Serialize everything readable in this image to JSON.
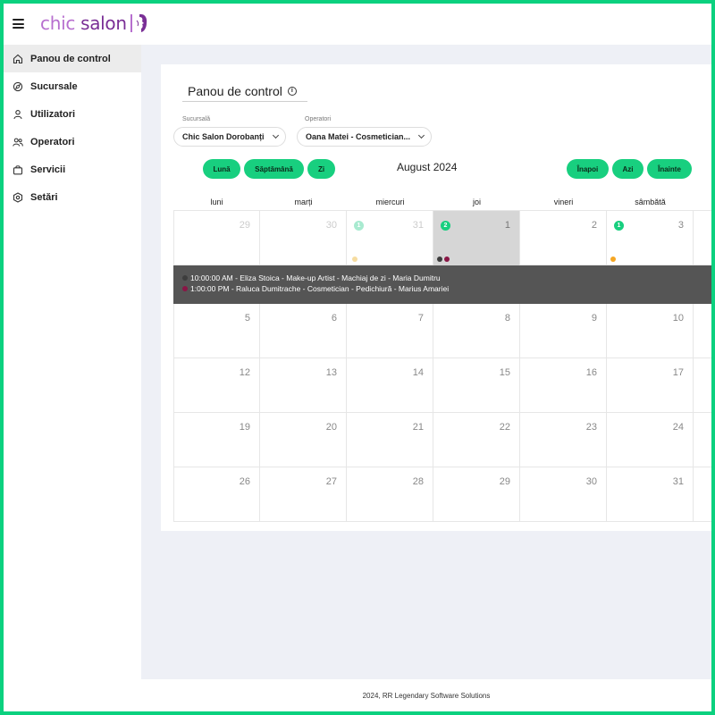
{
  "app": {
    "logo_chic": "chic ",
    "logo_salon": "salon",
    "footer": "2024, RR Legendary Software Solutions"
  },
  "sidebar": {
    "items": [
      {
        "label": "Panou de control",
        "icon": "home-icon"
      },
      {
        "label": "Sucursale",
        "icon": "compass-icon"
      },
      {
        "label": "Utilizatori",
        "icon": "user-icon"
      },
      {
        "label": "Operatori",
        "icon": "users-icon"
      },
      {
        "label": "Servicii",
        "icon": "bag-icon"
      },
      {
        "label": "Setări",
        "icon": "settings-icon"
      }
    ]
  },
  "dashboard": {
    "title": "Panou de control",
    "branch_label": "Sucursală",
    "branch_value": "Chic Salon Dorobanți",
    "operator_label": "Operatori",
    "operator_value": "Oana Matei - Cosmetician...",
    "view_month": "Lună",
    "view_week": "Săptămână",
    "view_day": "Zi",
    "month_title": "August 2024",
    "nav_back": "Înapoi",
    "nav_today": "Azi",
    "nav_next": "Înainte"
  },
  "calendar": {
    "weekdays": [
      "luni",
      "marți",
      "miercuri",
      "joi",
      "vineri",
      "sâmbătă"
    ],
    "week1": [
      {
        "num": "29",
        "muted": true
      },
      {
        "num": "30",
        "muted": true
      },
      {
        "num": "31",
        "muted": true,
        "badge": "1",
        "badge_faded": true,
        "dots": [
          "#f6dca0"
        ]
      },
      {
        "num": "1",
        "today": true,
        "badge": "2",
        "dots": [
          "#3d3d3d",
          "#8a1646"
        ]
      },
      {
        "num": "2"
      },
      {
        "num": "3",
        "badge": "1",
        "dots": [
          "#f5a623"
        ]
      }
    ],
    "weeks": [
      [
        "5",
        "6",
        "7",
        "8",
        "9",
        "10"
      ],
      [
        "12",
        "13",
        "14",
        "15",
        "16",
        "17"
      ],
      [
        "19",
        "20",
        "21",
        "22",
        "23",
        "24"
      ],
      [
        "26",
        "27",
        "28",
        "29",
        "30",
        "31"
      ]
    ],
    "events": [
      {
        "text": "10:00:00 AM - Eliza Stoica - Make-up Artist - Machiaj de zi - Maria Dumitru",
        "color": "#3d3d3d"
      },
      {
        "text": "1:00:00 PM - Raluca Dumitrache - Cosmetician - Pedichiură - Marius Amariei",
        "color": "#8a1646"
      }
    ]
  }
}
